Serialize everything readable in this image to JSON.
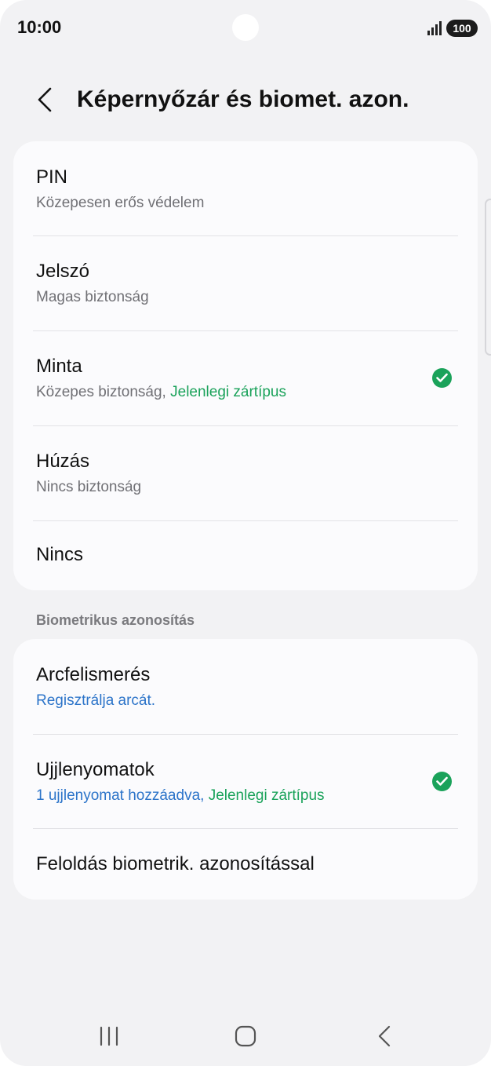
{
  "status_bar": {
    "time": "10:00",
    "battery": "100",
    "icons": [
      "signal-icon",
      "battery-icon"
    ]
  },
  "header": {
    "title": "Képernyőzár és biomet. azon.",
    "back_icon": "chevron-left-icon"
  },
  "lock_types": [
    {
      "title": "PIN",
      "subtitle": "Közepesen erős védelem",
      "subtitle_extra": "",
      "checked": false
    },
    {
      "title": "Jelszó",
      "subtitle": "Magas biztonság",
      "subtitle_extra": "",
      "checked": false
    },
    {
      "title": "Minta",
      "subtitle": "Közepes biztonság, ",
      "subtitle_extra": "Jelenlegi zártípus",
      "checked": true
    },
    {
      "title": "Húzás",
      "subtitle": "Nincs biztonság",
      "subtitle_extra": "",
      "checked": false
    },
    {
      "title": "Nincs",
      "subtitle": "",
      "subtitle_extra": "",
      "checked": false
    }
  ],
  "biometrics": {
    "section_label": "Biometrikus azonosítás",
    "items": [
      {
        "title": "Arcfelismerés",
        "subtitle": "Regisztrálja arcát.",
        "subtitle_extra": "",
        "checked": false
      },
      {
        "title": "Ujjlenyomatok",
        "subtitle": "1 ujjlenyomat hozzáadva, ",
        "subtitle_extra": "Jelenlegi zártípus",
        "checked": true
      },
      {
        "title": "Feloldás biometrik. azonosítással",
        "subtitle": "",
        "subtitle_extra": "",
        "checked": false
      }
    ]
  },
  "colors": {
    "accent_green": "#1aa25a",
    "link_blue": "#2c74c9",
    "background": "#f2f2f4",
    "card": "#fbfbfd"
  },
  "navbar": {
    "icons": [
      "recents-icon",
      "home-icon",
      "back-icon"
    ]
  }
}
